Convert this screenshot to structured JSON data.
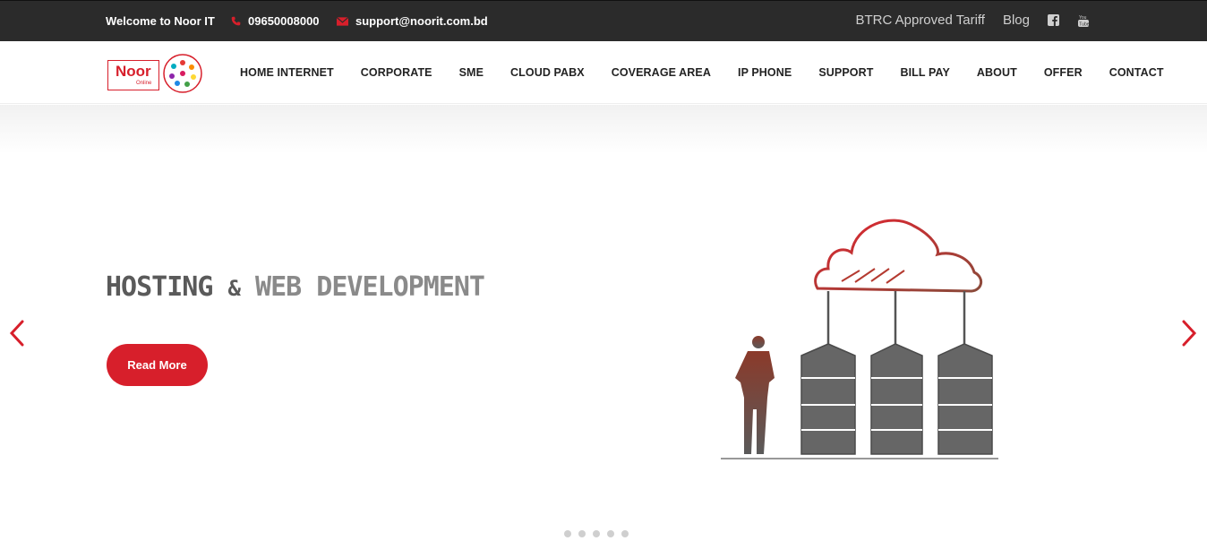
{
  "topbar": {
    "welcome": "Welcome to Noor IT",
    "phone": "09650008000",
    "email": "support@noorit.com.bd",
    "links": [
      "BTRC Approved Tariff",
      "Blog"
    ],
    "social_icons": [
      "facebook-icon",
      "youtube-icon"
    ]
  },
  "logo": {
    "name": "Noor",
    "tagline": "Online"
  },
  "nav": {
    "items": [
      "HOME INTERNET",
      "CORPORATE",
      "SME",
      "CLOUD PABX",
      "COVERAGE AREA",
      "IP PHONE",
      "SUPPORT",
      "BILL PAY",
      "ABOUT",
      "OFFER",
      "CONTACT"
    ]
  },
  "hero": {
    "headline_part1": "HOSTING",
    "headline_amp": "&",
    "headline_part2": "WEB DEVELOPMENT",
    "button": "Read More",
    "slides": 5,
    "active_slide": 1
  },
  "colors": {
    "accent": "#d71f2b",
    "topbar_bg": "#2b2b2b",
    "text_dark": "#222222",
    "headline_gray": "#5a5a5a"
  }
}
